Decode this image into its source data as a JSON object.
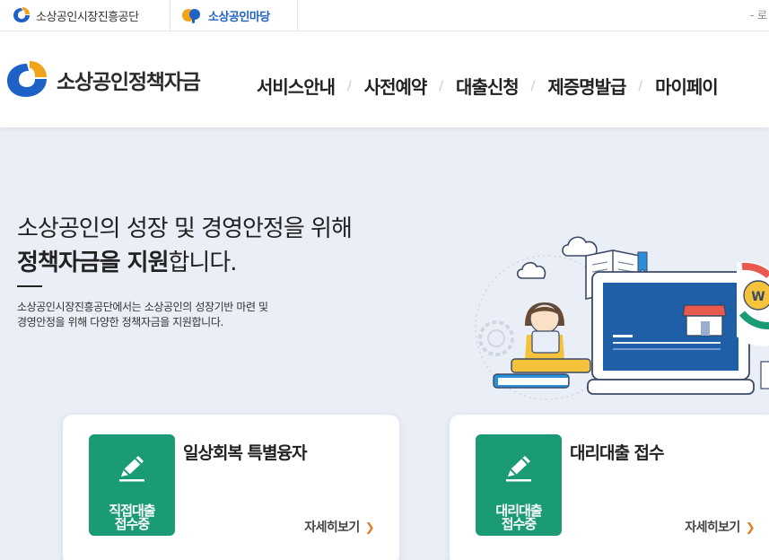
{
  "topbar": {
    "site1_label": "소상공인시장진흥공단",
    "site2_label": "소상공인마당",
    "right_text": "- 로"
  },
  "header": {
    "brand": "소상공인정책자금",
    "nav": [
      "서비스안내",
      "사전예약",
      "대출신청",
      "제증명발급",
      "마이페이"
    ]
  },
  "hero": {
    "title_line1": "소상공인의 성장 및 경영안정을 위해",
    "title_bold": "정책자금을 지원",
    "title_rest": "합니다.",
    "desc_line1": "소상공인시장진흥공단에서는 소상공인의 성장기반 마련 및",
    "desc_line2": "경영안정을 위해 다양한 정책자금을 지원합니다."
  },
  "cards": [
    {
      "badge_line1": "직접대출",
      "badge_line2": "접수중",
      "title": "일상회복 특별융자",
      "more": "자세히보기"
    },
    {
      "badge_line1": "대리대출",
      "badge_line2": "접수중",
      "title": "대리대출 접수",
      "more": "자세히보기"
    }
  ],
  "colors": {
    "accent_green": "#1a9b76",
    "arrow_orange": "#e87a1f",
    "logo_blue": "#1e62c8",
    "logo_orange": "#f2a31b"
  },
  "icons": [
    "semas-logo-icon",
    "madang-logo-icon",
    "pencil-icon",
    "chevron-right-icon"
  ]
}
